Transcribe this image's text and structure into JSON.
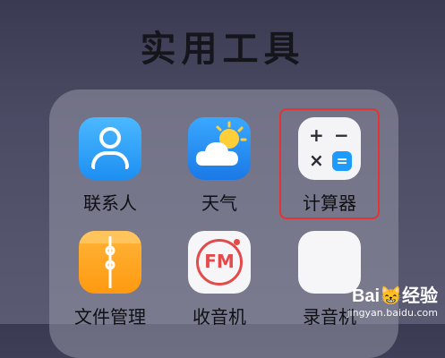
{
  "folder": {
    "title": "实用工具",
    "apps": [
      {
        "label": "联系人",
        "icon": "contacts-icon"
      },
      {
        "label": "天气",
        "icon": "weather-icon"
      },
      {
        "label": "计算器",
        "icon": "calculator-icon",
        "highlighted": true
      },
      {
        "label": "文件管理",
        "icon": "file-manager-icon"
      },
      {
        "label": "收音机",
        "icon": "fm-radio-icon"
      },
      {
        "label": "录音机",
        "icon": "recorder-icon"
      }
    ]
  },
  "calculator_icon": {
    "symbols": [
      "+",
      "−",
      "×"
    ]
  },
  "fm_icon": {
    "text": "FM"
  },
  "watermark": {
    "brand": "Bai😸经验",
    "url": "jingyan.baidu.com"
  },
  "colors": {
    "highlight": "#e53333",
    "accent_blue": "#1e9bff",
    "fm_red": "#e44a4a"
  }
}
